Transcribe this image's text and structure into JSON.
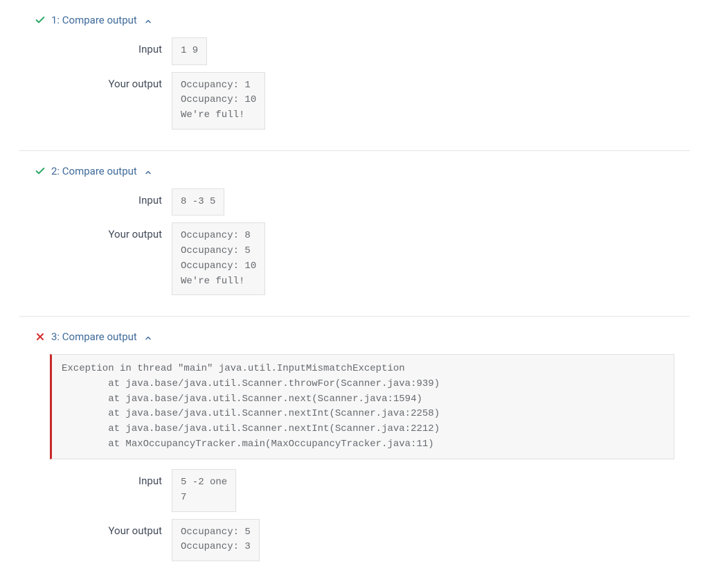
{
  "labels": {
    "input": "Input",
    "your_output": "Your output"
  },
  "tests": [
    {
      "status": "pass",
      "title": "1: Compare output",
      "input": "1 9",
      "your_output": "Occupancy: 1\nOccupancy: 10\nWe're full!"
    },
    {
      "status": "pass",
      "title": "2: Compare output",
      "input": "8 -3 5",
      "your_output": "Occupancy: 8\nOccupancy: 5\nOccupancy: 10\nWe're full!"
    },
    {
      "status": "fail",
      "title": "3: Compare output",
      "error": "Exception in thread \"main\" java.util.InputMismatchException\n        at java.base/java.util.Scanner.throwFor(Scanner.java:939)\n        at java.base/java.util.Scanner.next(Scanner.java:1594)\n        at java.base/java.util.Scanner.nextInt(Scanner.java:2258)\n        at java.base/java.util.Scanner.nextInt(Scanner.java:2212)\n        at MaxOccupancyTracker.main(MaxOccupancyTracker.java:11)",
      "input": "5 -2 one\n7",
      "your_output": "Occupancy: 5\nOccupancy: 3"
    }
  ]
}
